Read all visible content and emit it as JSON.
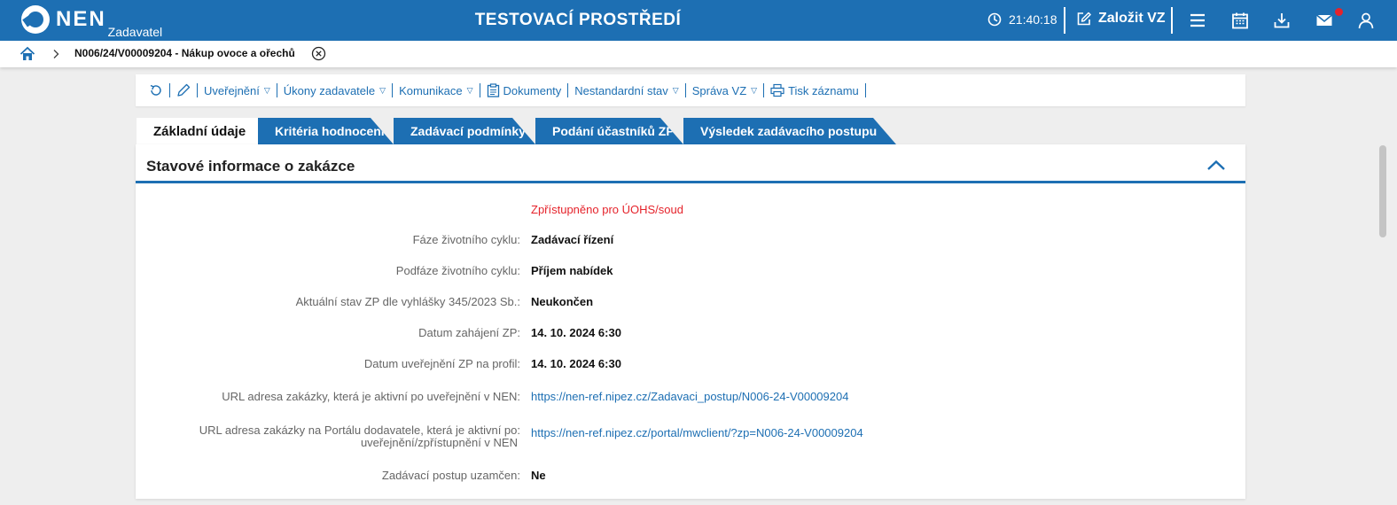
{
  "header": {
    "logo_text": "NEN",
    "logo_sub": "Zadavatel",
    "env_title": "TESTOVACÍ PROSTŘEDÍ",
    "clock_time": "21:40:18",
    "create_label": "Založit VZ"
  },
  "breadcrumb": {
    "label": "N006/24/V00009204 - Nákup ovoce a ořechů"
  },
  "toolbar": {
    "items": [
      {
        "label": "Uveřejnění"
      },
      {
        "label": "Úkony zadavatele"
      },
      {
        "label": "Komunikace"
      },
      {
        "label": "Dokumenty"
      },
      {
        "label": "Nestandardní stav"
      },
      {
        "label": "Správa VZ"
      },
      {
        "label": "Tisk záznamu"
      }
    ]
  },
  "tabs": [
    {
      "label": "Základní údaje",
      "active": true
    },
    {
      "label": "Kritéria hodnocení"
    },
    {
      "label": "Zadávací podmínky"
    },
    {
      "label": "Podání účastníků ZP"
    },
    {
      "label": "Výsledek zadávacího postupu"
    }
  ],
  "panel": {
    "title": "Stavové informace o zakázce",
    "note": "Zpřístupněno pro ÚOHS/soud",
    "rows": [
      {
        "label": "Fáze životního cyklu:",
        "value": "Zadávací řízení"
      },
      {
        "label": "Podfáze životního cyklu:",
        "value": "Příjem nabídek"
      },
      {
        "label": "Aktuální stav ZP dle vyhlášky 345/2023 Sb.:",
        "value": "Neukončen"
      },
      {
        "label": "Datum zahájení ZP:",
        "value": "14. 10. 2024 6:30"
      },
      {
        "label": "Datum uveřejnění ZP na profil:",
        "value": "14. 10. 2024 6:30"
      },
      {
        "label": "URL adresa zakázky, která je aktivní po uveřejnění v NEN:",
        "value": "https://nen-ref.nipez.cz/Zadavaci_postup/N006-24-V00009204"
      },
      {
        "label_line1": "URL adresa zakázky na Portálu dodavatele, která je aktivní po:",
        "label_line2": "uveřejnění/zpřístupnění v NEN",
        "value": "https://nen-ref.nipez.cz/portal/mwclient/?zp=N006-24-V00009204"
      },
      {
        "label": "Zadávací postup uzamčen:",
        "value": "Ne"
      }
    ]
  },
  "colors": {
    "brand_blue": "#1d6fb3",
    "accent_red": "#e5232b"
  }
}
